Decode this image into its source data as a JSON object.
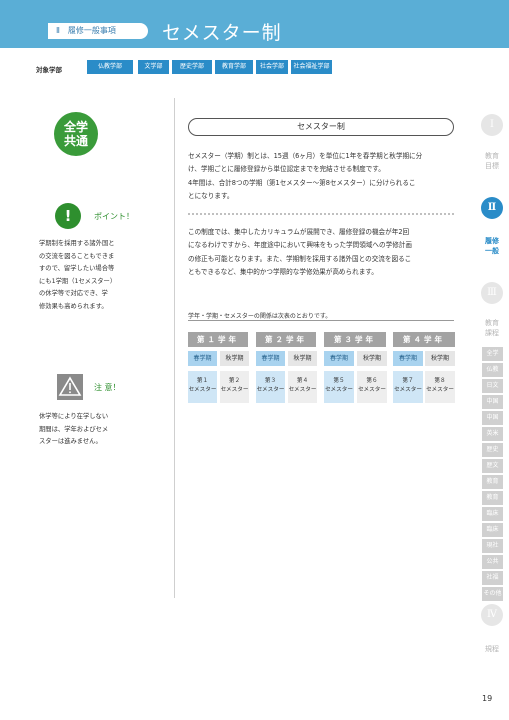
{
  "header": {
    "section": "Ⅱ　履修一般事項",
    "title": "セメスター制"
  },
  "target": {
    "label": "対象学部",
    "faculties": [
      "仏教学部",
      "文学部",
      "歴史学部",
      "教育学部",
      "社会学部",
      "社会福祉学部"
    ]
  },
  "left": {
    "badge_line1": "全学",
    "badge_line2": "共通",
    "point_label": "ポイント！",
    "point_lines": [
      "学期制を採用する諸外国と",
      "の交流を図ることもできま",
      "すので、留学したい場合等",
      "にも1学期（1セメスター）",
      "の休学等で対応でき、学",
      "修効果も高められます。"
    ],
    "caution_label": "注 意！",
    "caution_lines": [
      "休学等により在学しない",
      "期間は、学年およびセメ",
      "スターは進みません。"
    ]
  },
  "main": {
    "title": "セメスター制",
    "para1": [
      "セメスター（学期）制とは、15週（6ヶ月）を単位に1年を春学期と秋学期に分",
      "け、学期ごとに履修登録から単位認定までを完結させる制度です。",
      "4年間は、合計8つの学期（第1セメスター〜第8セメスター）に分けられるこ",
      "とになります。"
    ],
    "para2": [
      "この制度では、集中したカリキュラムが展開でき、履修登録の機会が年2回",
      "になるわけですから、年度途中において興味をもった学問領域への学修計画",
      "の修正も可能となります。また、学期制を採用する諸外国との交流を図るこ",
      "ともできるなど、集中的かつ学際的な学修効果が高められます。"
    ],
    "relation_label": "学年・学期・セメスターの関係は次表のとおりです。",
    "years": [
      "第１学年",
      "第２学年",
      "第３学年",
      "第４学年"
    ],
    "terms": [
      "春学期",
      "秋学期"
    ],
    "semesters": [
      "第１",
      "第２",
      "第３",
      "第４",
      "第５",
      "第６",
      "第７",
      "第８"
    ],
    "semester_unit": "セメスター"
  },
  "sidebar": {
    "roman": [
      "Ⅰ",
      "Ⅱ",
      "Ⅲ",
      "Ⅳ"
    ],
    "labels": [
      [
        "教育",
        "目標"
      ],
      [
        "履修",
        "一般"
      ],
      [
        "教育",
        "課程"
      ],
      [
        "規程"
      ]
    ],
    "subtabs": [
      "全学",
      "仏教",
      "日文",
      "中国",
      "中国",
      "英米",
      "歴史",
      "歴文",
      "教育",
      "教育",
      "臨床",
      "臨床",
      "現社",
      "公共",
      "社福",
      "その他"
    ]
  },
  "page_number": "19"
}
